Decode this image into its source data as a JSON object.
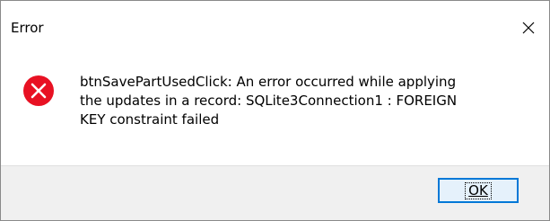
{
  "window": {
    "title": "Error",
    "close_icon": "close-icon"
  },
  "content": {
    "icon": "error-icon",
    "message": "btnSavePartUsedClick: An error occurred while applying\nthe updates in a record: SQLite3Connection1 : FOREIGN\nKEY constraint failed"
  },
  "buttons": {
    "ok_label": "OK"
  },
  "colors": {
    "error_red": "#e81123",
    "footer_bg": "#f0f0f0",
    "button_border": "#0078d7",
    "button_bg": "#e5f1fb"
  }
}
